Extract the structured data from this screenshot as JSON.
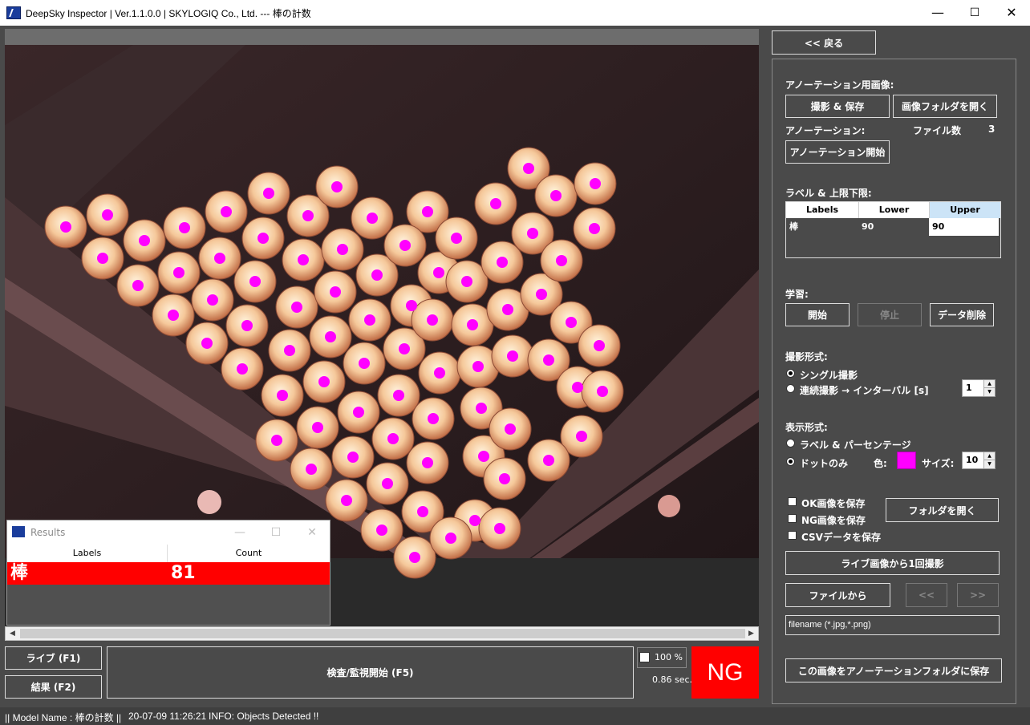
{
  "window": {
    "title": "DeepSky Inspector | Ver.1.1.0.0 | SKYLOGIQ Co., Ltd. --- 棒の計数",
    "minimize": "—",
    "maximize": "☐",
    "close": "✕"
  },
  "results_window": {
    "title": "Results",
    "col_labels": "Labels",
    "col_count": "Count",
    "row_label": "棒",
    "row_count": "81"
  },
  "bottom": {
    "live_btn": "ライブ (F1)",
    "result_btn": "結果 (F2)",
    "inspect_btn": "検査/監視開始 (F5)",
    "percent": "100 %",
    "time": "0.86 sec.",
    "judgement": "NG"
  },
  "statusbar": {
    "model": "|| Model Name : 棒の計数 ||",
    "timestamp": "20-07-09 11:26:21",
    "info": "INFO:   Objects Detected !!"
  },
  "panel": {
    "back_btn": "<< 戻る",
    "annotation_image_label": "アノーテーション用画像:",
    "capture_save_btn": "撮影 & 保存",
    "open_image_folder_btn": "画像フォルダを開く",
    "annotation_label": "アノーテーション:",
    "file_count_label": "ファイル数",
    "file_count_value": "3",
    "annotation_start_btn": "アノーテーション開始",
    "label_limits_label": "ラベル & 上限下限:",
    "table": {
      "headers": [
        "Labels",
        "Lower",
        "Upper"
      ],
      "rows": [
        [
          "棒",
          "90",
          "90"
        ]
      ]
    },
    "learning_label": "学習:",
    "start_btn": "開始",
    "stop_btn": "停止",
    "delete_data_btn": "データ削除",
    "capture_mode_label": "撮影形式:",
    "single_capture": "シングル撮影",
    "continuous_capture": "連続撮影 → インターバル [s]",
    "interval_value": "1",
    "display_mode_label": "表示形式:",
    "label_percentage": "ラベル & パーセンテージ",
    "dots_only": "ドットのみ",
    "color_label": "色:",
    "size_label": "サイズ:",
    "size_value": "10",
    "dot_color": "#ff00ff",
    "save_ok": "OK画像を保存",
    "save_ng": "NG画像を保存",
    "save_csv": "CSVデータを保存",
    "open_folder_btn": "フォルダを開く",
    "capture_once_btn": "ライブ画像から1回撮影",
    "from_file_btn": "ファイルから",
    "prev_btn": "<<",
    "next_btn": ">>",
    "filename_placeholder": "filename (*.jpg,*.png)",
    "save_to_annotation_btn": "この画像をアノーテーションフォルダに保存"
  }
}
